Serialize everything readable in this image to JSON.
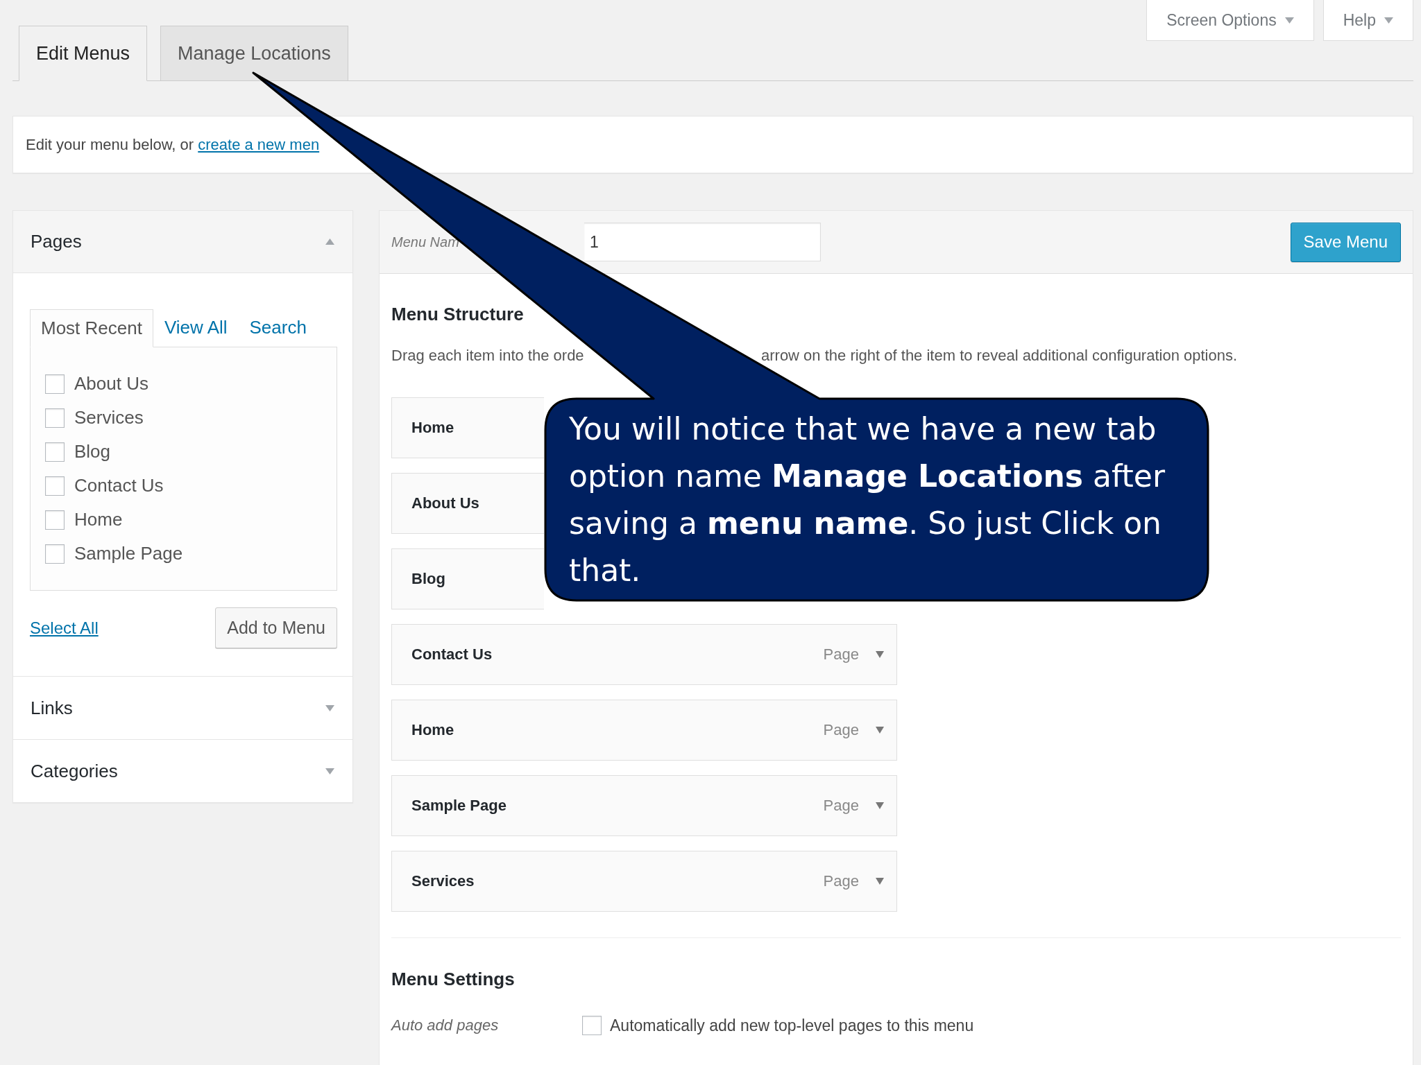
{
  "screen_meta": [
    "Screen Options",
    "Help"
  ],
  "tabs": [
    {
      "label": "Edit Menus",
      "selected": true
    },
    {
      "label": "Manage Locations",
      "selected": false
    }
  ],
  "notice": {
    "text": "Edit your menu below, or",
    "link": "create a new men"
  },
  "sidebar": {
    "sections": [
      {
        "title": "Pages",
        "expanded": true,
        "tabs": [
          {
            "label": "Most Recent",
            "selected": true
          },
          {
            "label": "View All",
            "selected": false
          },
          {
            "label": "Search",
            "selected": false
          }
        ],
        "items": [
          {
            "label": "About Us",
            "checked": false
          },
          {
            "label": "Services",
            "checked": false
          },
          {
            "label": "Blog",
            "checked": false
          },
          {
            "label": "Contact Us",
            "checked": false
          },
          {
            "label": "Home",
            "checked": false
          },
          {
            "label": "Sample Page",
            "checked": false
          }
        ],
        "select_all": "Select All",
        "add_button": "Add to Menu"
      },
      {
        "title": "Links",
        "expanded": false
      },
      {
        "title": "Categories",
        "expanded": false
      }
    ]
  },
  "menu_editor": {
    "name_label": "Menu Nam",
    "name_value": "1",
    "save_button": "Save Menu",
    "structure_title": "Menu Structure",
    "instructions": [
      "Drag each item into the orde",
      "arrow on the right of the item to reveal additional configuration options."
    ],
    "items": [
      {
        "title": "Home"
      },
      {
        "title": "About Us"
      },
      {
        "title": "Blog"
      },
      {
        "title": "Contact Us",
        "type": "Page"
      },
      {
        "title": "Home",
        "type": "Page"
      },
      {
        "title": "Sample Page",
        "type": "Page"
      },
      {
        "title": "Services",
        "type": "Page"
      }
    ],
    "settings_title": "Menu Settings",
    "settings": [
      {
        "label": "Auto add pages",
        "option": "Automatically add new top-level pages to this menu",
        "checked": false
      }
    ]
  },
  "callout": {
    "text": "You will notice that we have a new tab option name **Manage Locations** after saving a **menu name**. So just Click on that."
  }
}
